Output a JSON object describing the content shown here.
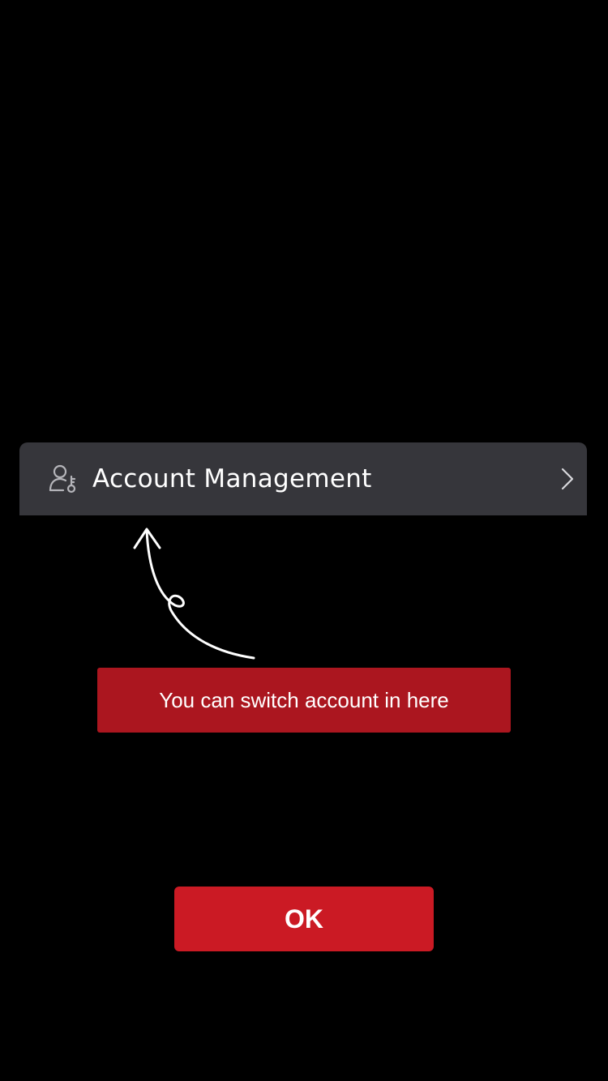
{
  "menu_item": {
    "label": "Account Management",
    "icon": "user-key-icon",
    "trailing_icon": "chevron-right-icon"
  },
  "guide": {
    "arrow_icon": "curved-arrow-up-icon",
    "tip_text": "You can switch account in here"
  },
  "ok_button": {
    "label": "OK"
  },
  "colors": {
    "background": "#000000",
    "row_background": "#36363b",
    "tip_background": "#ab161f",
    "button_background": "#cb1a24",
    "text": "#ffffff",
    "icon": "#b5b5ba"
  }
}
